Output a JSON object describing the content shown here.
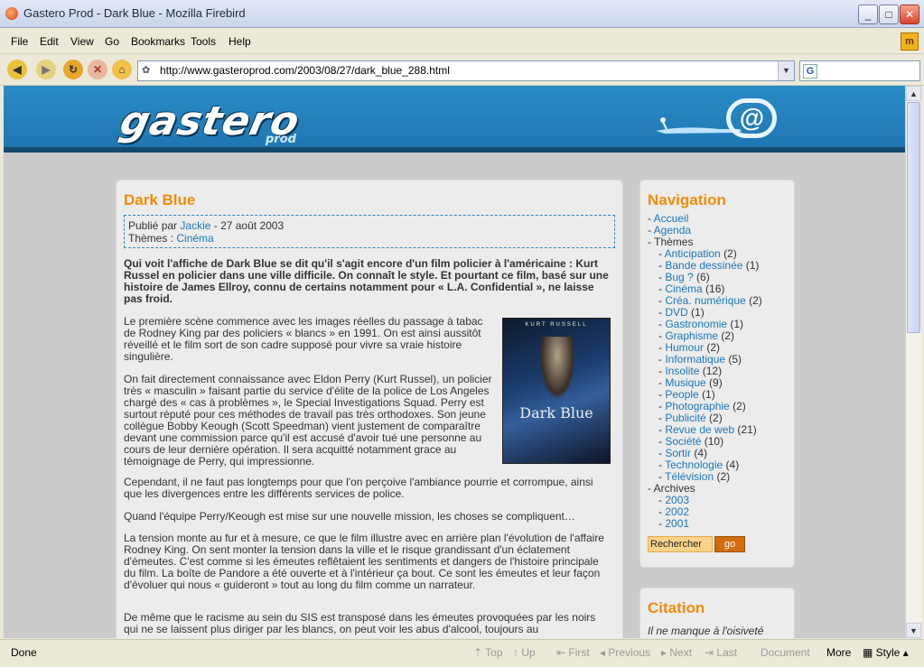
{
  "window": {
    "title": "Gastero Prod - Dark Blue - Mozilla Firebird"
  },
  "menu": [
    "File",
    "Edit",
    "View",
    "Go",
    "Bookmarks",
    "Tools",
    "Help"
  ],
  "url": "http://www.gasteroprod.com/2003/08/27/dark_blue_288.html",
  "banner": {
    "logo": "gastero",
    "logo_sub": "prod"
  },
  "article": {
    "title": "Dark Blue",
    "meta_prefix": "Publié par",
    "author": "Jackie",
    "date": "- 27 août 2003",
    "themes_label": "Thèmes :",
    "theme": "Cinéma",
    "intro": "Qui voit l'affiche de Dark Blue se dit qu'il s'agit encore d'un film policier à l'américaine : Kurt Russel en policier dans une ville difficile. On connaît le style. Et pourtant ce film, basé sur une histoire de James Ellroy, connu de certains notamment pour « L.A. Confidential », ne laisse pas froid.",
    "p1": "Le première scène commence avec les images réelles du passage à tabac de Rodney King par des policiers « blancs » en 1991. On est ainsi aussitôt réveillé et le film sort de son cadre supposé pour vivre sa vraie histoire singulière.",
    "p2": "On fait directement connaissance avec Eldon Perry (Kurt Russel), un policier très « masculin » faisant partie du service d'élite de la police de Los Angeles chargé des « cas à problèmes », le Special Investigations Squad. Perry est surtout réputé pour ces méthodes de travail pas très orthodoxes. Son jeune collègue Bobby Keough (Scott Speedman) vient justement de comparaître devant une commission parce qu'il est accusé d'avoir tué une personne au cours de leur dernière opération. Il sera acquitté notamment grace au témoignage de Perry, qui impressionne.",
    "p3": "Cependant, il ne faut pas longtemps pour que l'on perçoive l'ambiance pourrie et corrompue, ainsi que les divergences entre les différents services de police.",
    "p4": "Quand l'équipe Perry/Keough est mise sur une nouvelle mission, les choses se compliquent…",
    "p5": "La tension monte au fur et à mesure, ce que le film illustre avec en arrière plan l'évolution de l'affaire Rodney King. On sent monter la tension dans la ville et le risque grandissant d'un éclatement d'émeutes. C'est comme si les émeutes reflêtaient les sentiments et dangers de l'histoire principale du film. La boîte de Pandore a été ouverte et à l'intérieur ça bout. Ce sont les émeutes et leur façon d'évoluer qui nous « guideront » tout au long du film comme un narrateur.",
    "p6": "De même que le racisme au sein du SIS est transposé dans les émeutes provoquées par les noirs qui ne se laissent plus diriger par les blancs, on peut voir les abus d'alcool, toujours au",
    "poster": {
      "top": "KURT RUSSELL",
      "title": "Dark Blue"
    }
  },
  "navigation": {
    "title": "Navigation",
    "links": [
      {
        "label": "Accueil"
      },
      {
        "label": "Agenda"
      }
    ],
    "themes_label": "Thèmes",
    "themes": [
      {
        "label": "Anticipation",
        "count": "(2)"
      },
      {
        "label": "Bande dessinée",
        "count": "(1)"
      },
      {
        "label": "Bug ?",
        "count": "(6)"
      },
      {
        "label": "Cinéma",
        "count": "(16)"
      },
      {
        "label": "Créa. numérique",
        "count": "(2)"
      },
      {
        "label": "DVD",
        "count": "(1)"
      },
      {
        "label": "Gastronomie",
        "count": "(1)"
      },
      {
        "label": "Graphisme",
        "count": "(2)"
      },
      {
        "label": "Humour",
        "count": "(2)"
      },
      {
        "label": "Informatique",
        "count": "(5)"
      },
      {
        "label": "Insolite",
        "count": "(12)"
      },
      {
        "label": "Musique",
        "count": "(9)"
      },
      {
        "label": "People",
        "count": "(1)"
      },
      {
        "label": "Photographie",
        "count": "(2)"
      },
      {
        "label": "Publicité",
        "count": "(2)"
      },
      {
        "label": "Revue de web",
        "count": "(21)"
      },
      {
        "label": "Société",
        "count": "(10)"
      },
      {
        "label": "Sortir",
        "count": "(4)"
      },
      {
        "label": "Technologie",
        "count": "(4)"
      },
      {
        "label": "Télévision",
        "count": "(2)"
      }
    ],
    "archives_label": "Archives",
    "archives": [
      "2003",
      "2002",
      "2001"
    ],
    "search_value": "Rechercher",
    "go_label": "go"
  },
  "citation": {
    "title": "Citation",
    "text": "Il ne manque à l'oisiveté"
  },
  "status": {
    "done": "Done",
    "links": [
      "Top",
      "Up",
      "First",
      "Previous",
      "Next",
      "Last",
      "Document",
      "More",
      "Style"
    ]
  },
  "colors": {
    "accent": "#f08c0c",
    "link": "#1b78b8",
    "banner": "#1f77b2"
  }
}
